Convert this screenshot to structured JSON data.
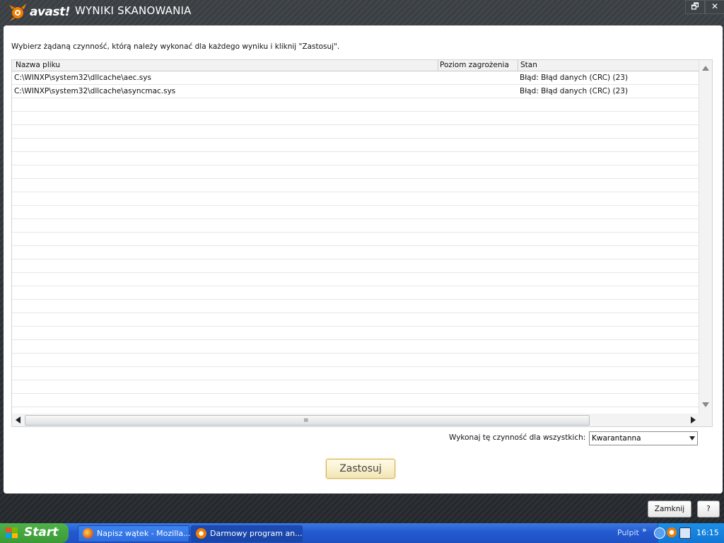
{
  "window": {
    "brand": "avast!",
    "title": "WYNIKI SKANOWANIA",
    "restore_glyph": "🗗",
    "close_glyph": "✕"
  },
  "instruction": "Wybierz żądaną czynność, którą należy wykonać dla każdego wyniku i kliknij \"Zastosuj\".",
  "table": {
    "columns": [
      "Nazwa pliku",
      "Poziom zagrożenia",
      "Stan"
    ],
    "rows": [
      {
        "file": "C:\\WINXP\\system32\\dllcache\\aec.sys",
        "level": "",
        "status": "Błąd: Błąd danych (CRC) (23)"
      },
      {
        "file": "C:\\WINXP\\system32\\dllcache\\asyncmac.sys",
        "level": "",
        "status": "Błąd: Błąd danych (CRC) (23)"
      }
    ],
    "hscroll_grip": "≡"
  },
  "apply_all": {
    "label": "Wykonaj tę czynność dla wszystkich:",
    "selected": "Kwarantanna"
  },
  "buttons": {
    "apply": "Zastosuj",
    "close": "Zamknij",
    "help": "?"
  },
  "taskbar": {
    "start": "Start",
    "tasks": [
      {
        "label": "Napisz wątek - Mozilla...",
        "icon": "firefox-icon"
      },
      {
        "label": "Darmowy program an...",
        "icon": "avast-icon"
      }
    ],
    "pulpit": "Pulpit",
    "chevron": "»",
    "clock": "16:15"
  },
  "colors": {
    "avast_orange": "#f07c00",
    "taskbar_blue": "#235ad1",
    "start_green": "#3b9a36",
    "apply_border": "#d5b35a"
  }
}
